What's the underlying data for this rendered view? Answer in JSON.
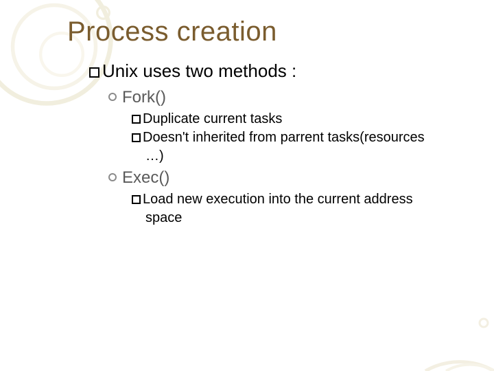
{
  "title": "Process creation",
  "bullet1": {
    "label": "Unix uses two methods :"
  },
  "fork": {
    "label": "Fork()",
    "points": [
      "Duplicate current tasks",
      "Doesn't inherited from parrent tasks(resources",
      "…)"
    ]
  },
  "exec": {
    "label": "Exec()",
    "points": [
      "Load new execution into the current address",
      "space"
    ]
  }
}
